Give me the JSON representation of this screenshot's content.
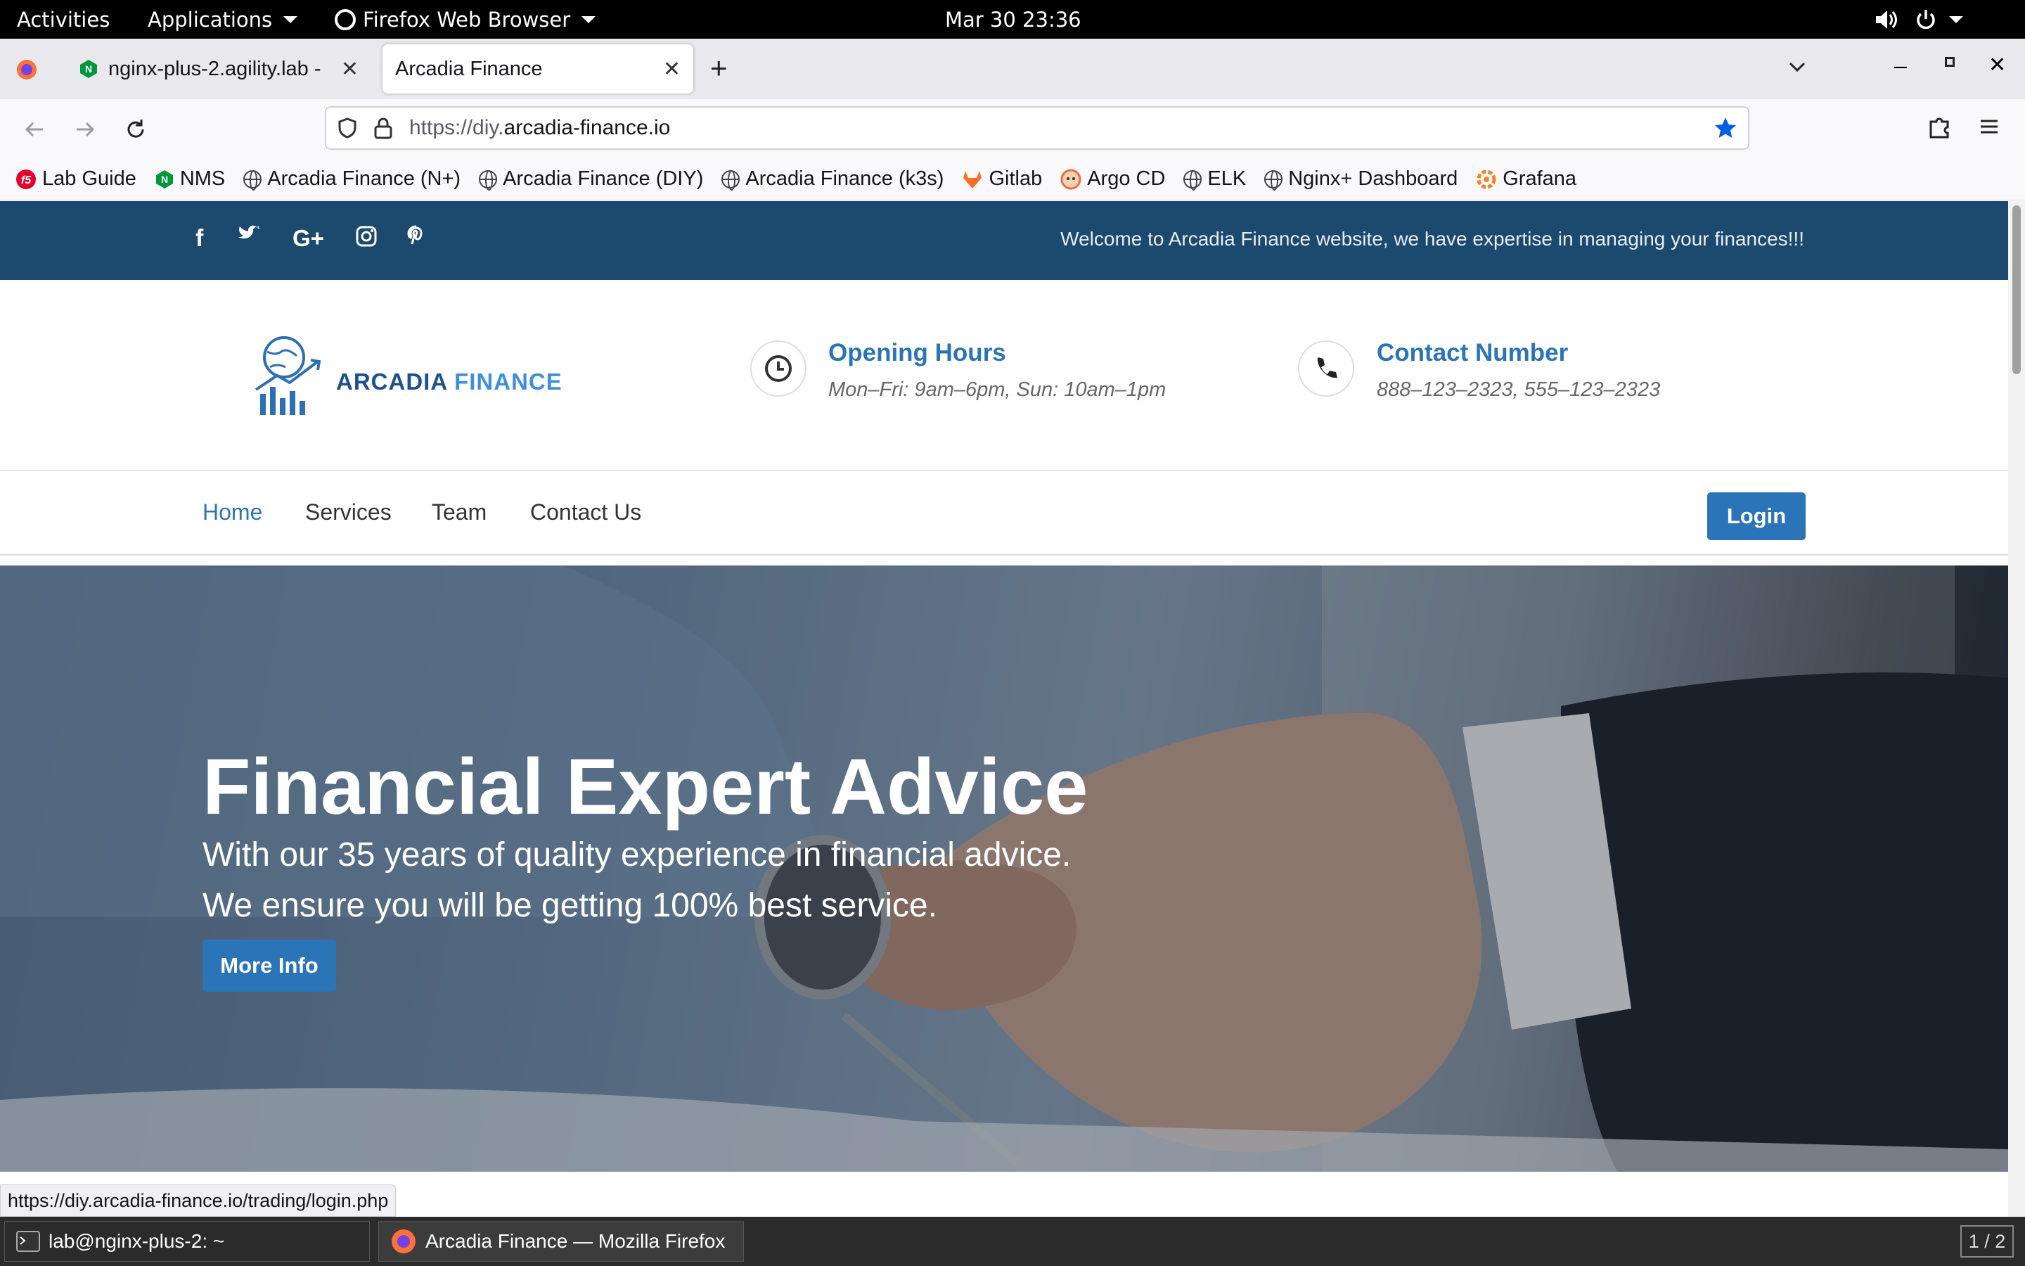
{
  "gnome": {
    "activities": "Activities",
    "applications": "Applications",
    "app_name": "Firefox Web Browser",
    "clock": "Mar 30  23:36"
  },
  "tabs": [
    {
      "label": "nginx-plus-2.agility.lab - ",
      "active": false
    },
    {
      "label": "Arcadia Finance",
      "active": true
    }
  ],
  "url": {
    "prefix": "https://diy.",
    "host": "arcadia-finance.io"
  },
  "bookmarks": [
    {
      "label": "Lab Guide",
      "icon": "f5-icon"
    },
    {
      "label": "NMS",
      "icon": "nginx-icon"
    },
    {
      "label": "Arcadia Finance (N+)",
      "icon": "globe-icon"
    },
    {
      "label": "Arcadia Finance (DIY)",
      "icon": "globe-icon"
    },
    {
      "label": "Arcadia Finance (k3s)",
      "icon": "globe-icon"
    },
    {
      "label": "Gitlab",
      "icon": "gitlab-icon"
    },
    {
      "label": "Argo CD",
      "icon": "argo-icon"
    },
    {
      "label": "ELK",
      "icon": "globe-icon"
    },
    {
      "label": "Nginx+ Dashboard",
      "icon": "globe-icon"
    },
    {
      "label": "Grafana",
      "icon": "grafana-icon"
    }
  ],
  "site": {
    "social_icons": [
      "f",
      "t",
      "G+",
      "ig",
      "p"
    ],
    "welcome": "Welcome to Arcadia Finance website, we have expertise in managing your finances!!!",
    "logo_part1": "ARCADIA ",
    "logo_part2": "FINANCE",
    "hours_title": "Opening Hours",
    "hours_text": "Mon–Fri: 9am–6pm, Sun: 10am–1pm",
    "contact_title": "Contact Number",
    "contact_text": "888–123–2323, 555–123–2323",
    "menu": [
      "Home",
      "Services",
      "Team",
      "Contact Us"
    ],
    "login": "Login",
    "hero_title": "Financial Expert Advice",
    "hero_line1": "With our 35 years of quality experience in financial advice.",
    "hero_line2": "We ensure you will be getting 100% best service.",
    "hero_button": "More Info"
  },
  "status_url": "https://diy.arcadia-finance.io/trading/login.php",
  "taskbar": {
    "terminal": "lab@nginx-plus-2: ~",
    "firefox": "Arcadia Finance — Mozilla Firefox",
    "workspace": "1 / 2"
  },
  "colors": {
    "brand_blue": "#2b74b8",
    "topstrip": "#1b4a6e"
  }
}
